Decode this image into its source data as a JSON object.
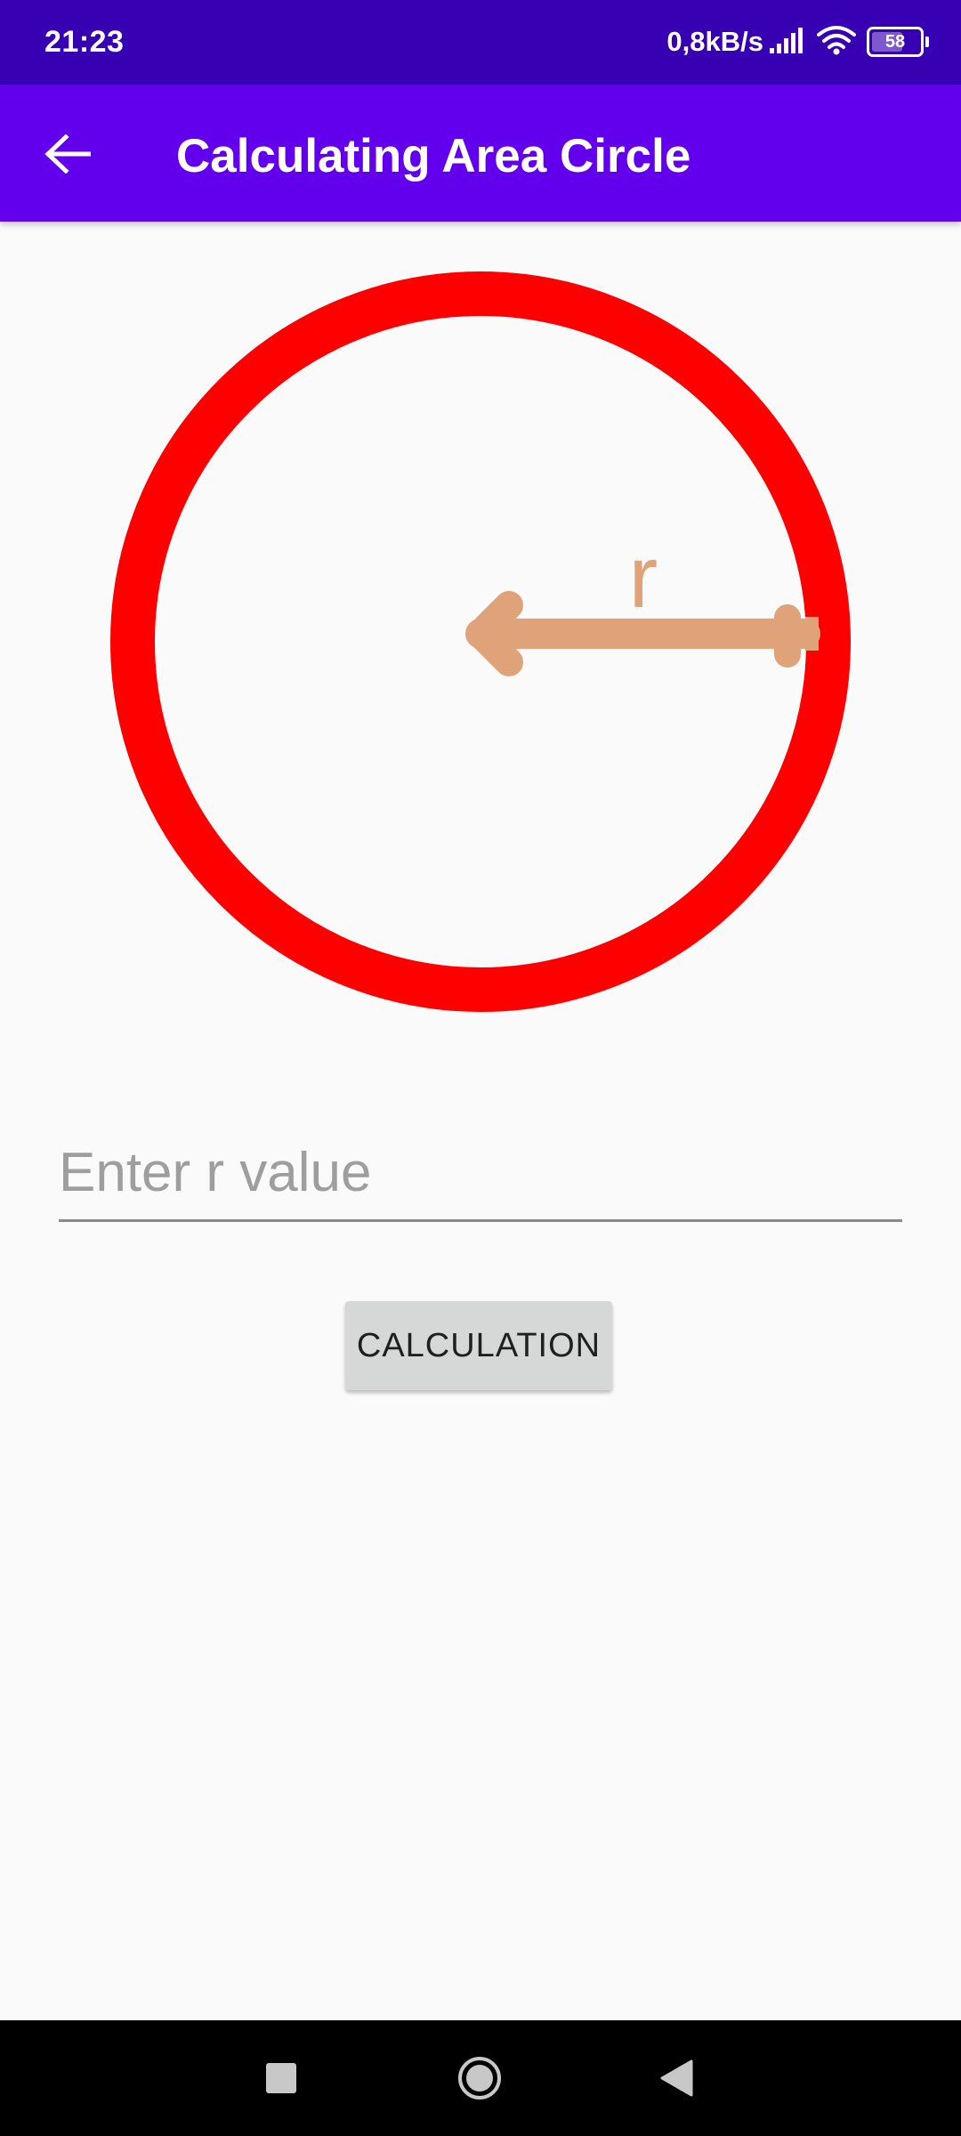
{
  "status_bar": {
    "time": "21:23",
    "net_speed": "0,8kB/s",
    "battery_level": "58",
    "icons": [
      "signal-icon",
      "wifi-icon",
      "battery-icon"
    ]
  },
  "app_bar": {
    "title": "Calculating Area Circle",
    "back_icon": "arrow-back-icon"
  },
  "diagram": {
    "radius_label": "r",
    "circle_color": "#ff0000",
    "arrow_color": "#dfa279"
  },
  "form": {
    "input_value": "",
    "input_placeholder": "Enter r value",
    "button_label": "CALCULATION"
  },
  "nav_bar": {
    "icons": [
      "recents-square-icon",
      "home-circle-icon",
      "back-triangle-icon"
    ]
  },
  "colors": {
    "status_bar": "#3700b3",
    "app_bar": "#6200ee",
    "background": "#fafafa",
    "button": "#d6d7d7"
  }
}
